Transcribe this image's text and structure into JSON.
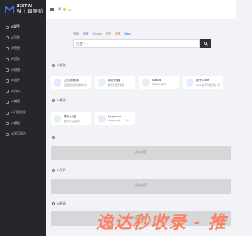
{
  "brand": {
    "name": "BEST AI",
    "subtitle": "AI工具导航"
  },
  "sidebar": {
    "items": [
      {
        "label": "AI助手"
      },
      {
        "label": "AI写作"
      },
      {
        "label": "AI绘画"
      },
      {
        "label": "AI音乐"
      },
      {
        "label": "AI视频"
      },
      {
        "label": "AI设计"
      },
      {
        "label": "AI办公"
      },
      {
        "label": "AI编程"
      },
      {
        "label": "AI开发框架"
      },
      {
        "label": "AI模型"
      },
      {
        "label": "AI学习网站"
      }
    ]
  },
  "topbar": {
    "weather_city": "晴",
    "weather_temp": "°C"
  },
  "search": {
    "tabs": [
      "常用",
      "百度",
      "Google",
      "知乎",
      "淘宝",
      "Bing"
    ],
    "placeholder": "百度一下"
  },
  "sections": [
    {
      "title": "AI智能",
      "cards": [
        {
          "name": "文心智能体",
          "desc": "百度推出的智能体平台",
          "color": "#e9e4ff"
        },
        {
          "name": "腾讯元器",
          "desc": "腾讯元器智能体",
          "color": "#e6f0ff"
        },
        {
          "name": "Manus",
          "desc": "Auto AI Agent",
          "color": "#eeeeee"
        },
        {
          "name": "扣子Coze",
          "desc": "Coze是字节推出的一款...",
          "color": "#e6edff"
        }
      ]
    },
    {
      "title": "AI聊天",
      "cards": [
        {
          "name": "腾讯元宝",
          "desc": "腾讯元宝是腾讯",
          "color": "#e0f6ec"
        },
        {
          "name": "Deepseek",
          "desc": "Deepseek是一个人...",
          "color": "#e6ecff"
        }
      ]
    },
    {
      "title": "",
      "empty": "没有内容"
    },
    {
      "title": "AI写作",
      "empty": "没有内容"
    },
    {
      "title": "AI绘画",
      "empty": "没有内容"
    }
  ],
  "watermark": "逸达秒收录 - 推"
}
